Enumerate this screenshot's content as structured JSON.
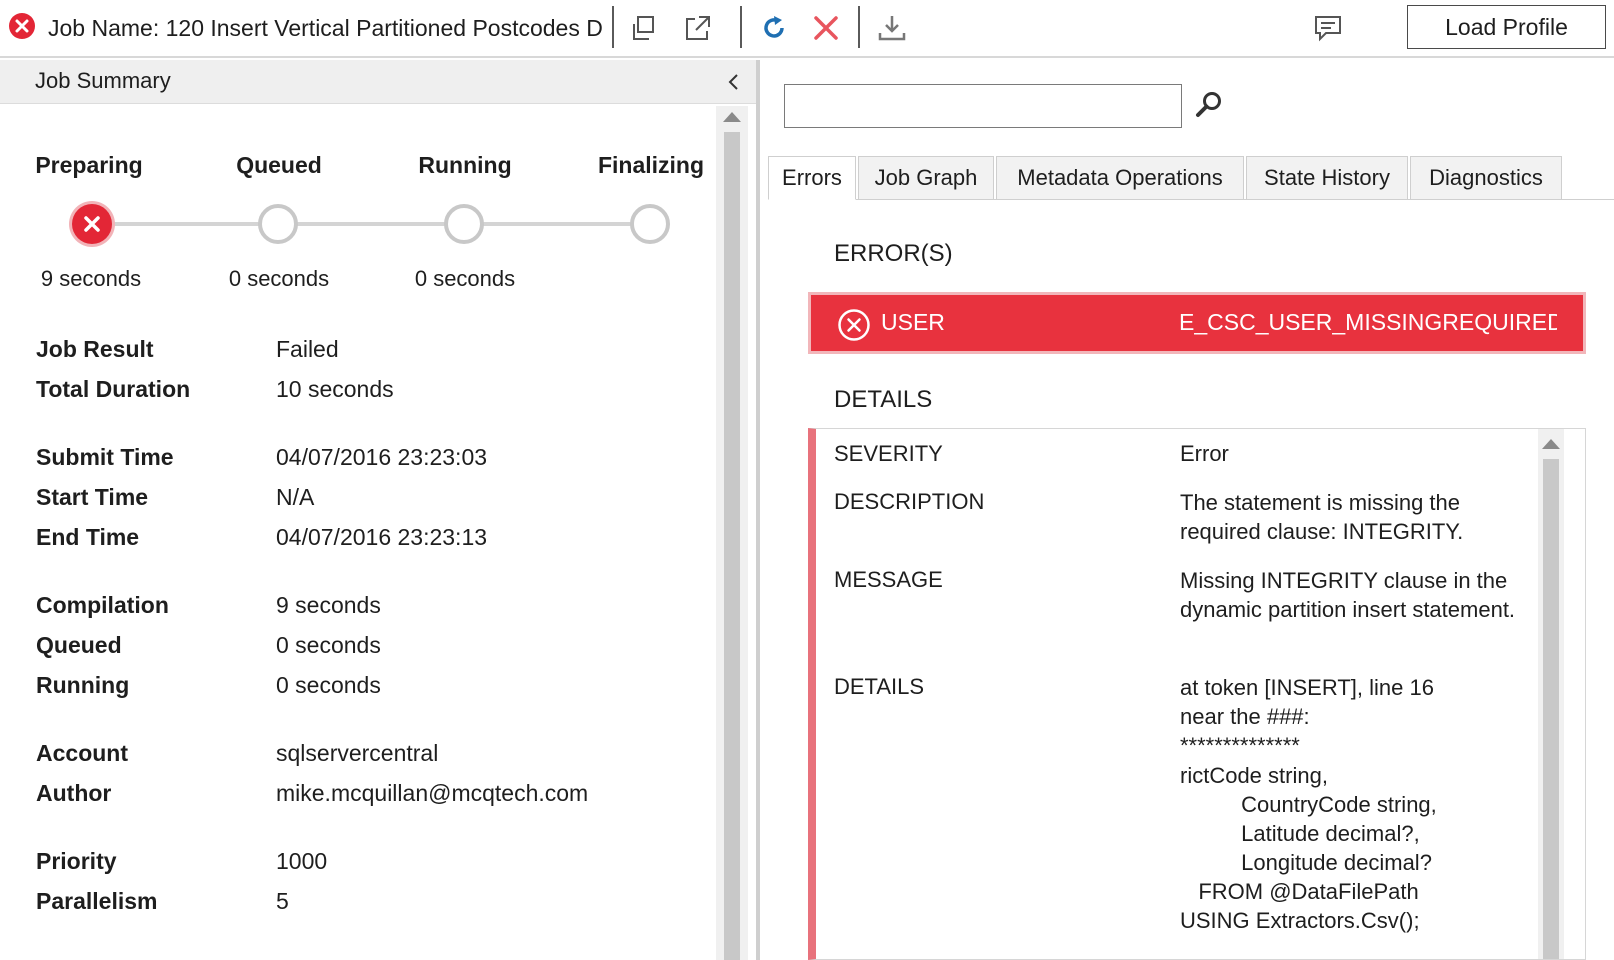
{
  "toolbar": {
    "status_icon": "error-circle-icon",
    "job_name": "Job Name:  120 Insert Vertical Partitioned Postcodes D",
    "icons": [
      "copy-icon",
      "open-external-icon",
      "refresh-icon",
      "cancel-x-icon",
      "download-icon",
      "feedback-icon"
    ],
    "load_profile_label": "Load Profile",
    "colors": {
      "refresh": "#1f6fb2",
      "cancel": "#e8555e",
      "error": "#e32636"
    }
  },
  "summary": {
    "title": "Job Summary",
    "stages": [
      {
        "label": "Preparing",
        "time": "9 seconds",
        "status": "error"
      },
      {
        "label": "Queued",
        "time": "0 seconds",
        "status": "pending"
      },
      {
        "label": "Running",
        "time": "0 seconds",
        "status": "pending"
      },
      {
        "label": "Finalizing",
        "time": "",
        "status": "pending"
      }
    ],
    "fields": [
      {
        "key": "Job Result",
        "value": "Failed"
      },
      {
        "key": "Total Duration",
        "value": "10 seconds"
      },
      {
        "key": "Submit Time",
        "value": "04/07/2016 23:23:03"
      },
      {
        "key": "Start Time",
        "value": "N/A"
      },
      {
        "key": "End Time",
        "value": "04/07/2016 23:23:13"
      },
      {
        "key": "Compilation",
        "value": "9 seconds"
      },
      {
        "key": "Queued",
        "value": "0 seconds"
      },
      {
        "key": "Running",
        "value": "0 seconds"
      },
      {
        "key": "Account",
        "value": "sqlservercentral"
      },
      {
        "key": "Author",
        "value": "mike.mcquillan@mcqtech.com"
      },
      {
        "key": "Priority",
        "value": "1000"
      },
      {
        "key": "Parallelism",
        "value": "5"
      }
    ]
  },
  "search": {
    "value": "",
    "placeholder": ""
  },
  "tabs": [
    "Errors",
    "Job Graph",
    "Metadata Operations",
    "State History",
    "Diagnostics"
  ],
  "errors": {
    "section_title": "ERROR(S)",
    "banner": {
      "category": "USER",
      "code": "E_CSC_USER_MISSINGREQUIREDCLAUSE"
    },
    "details_title": "DETAILS",
    "details": {
      "severity_key": "SEVERITY",
      "severity_value": "Error",
      "description_key": "DESCRIPTION",
      "description_value": "The statement is missing the required clause: INTEGRITY.",
      "message_key": "MESSAGE",
      "message_value": "Missing INTEGRITY clause in the dynamic partition insert statement.",
      "details_key": "DETAILS",
      "details_value": "at token [INSERT], line 16\nnear the ###:\n**************",
      "code_value": "rictCode string,\n          CountryCode string,\n          Latitude decimal?,\n          Longitude decimal?\n   FROM @DataFilePath\nUSING Extractors.Csv();"
    }
  }
}
